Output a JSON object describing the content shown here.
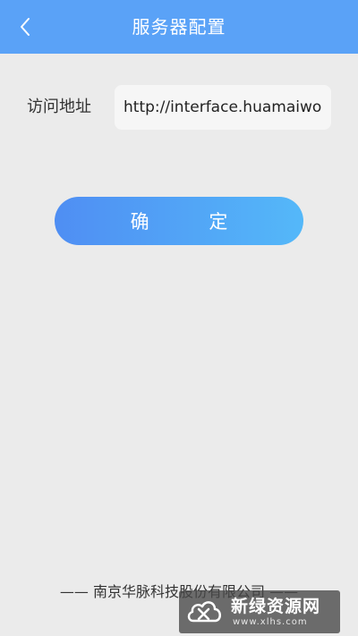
{
  "header": {
    "title": "服务器配置",
    "back_icon": "chevron-left-icon",
    "background_color": "#5aa2f7"
  },
  "form": {
    "label": "访问地址",
    "url_value": "http://interface.huamaiwo"
  },
  "confirm_button": {
    "label": "确 定"
  },
  "footer": {
    "text": "—— 南京华脉科技股份有限公司 ——"
  },
  "watermark": {
    "title": "新绿资源网",
    "url": "www.xlhs.com"
  }
}
